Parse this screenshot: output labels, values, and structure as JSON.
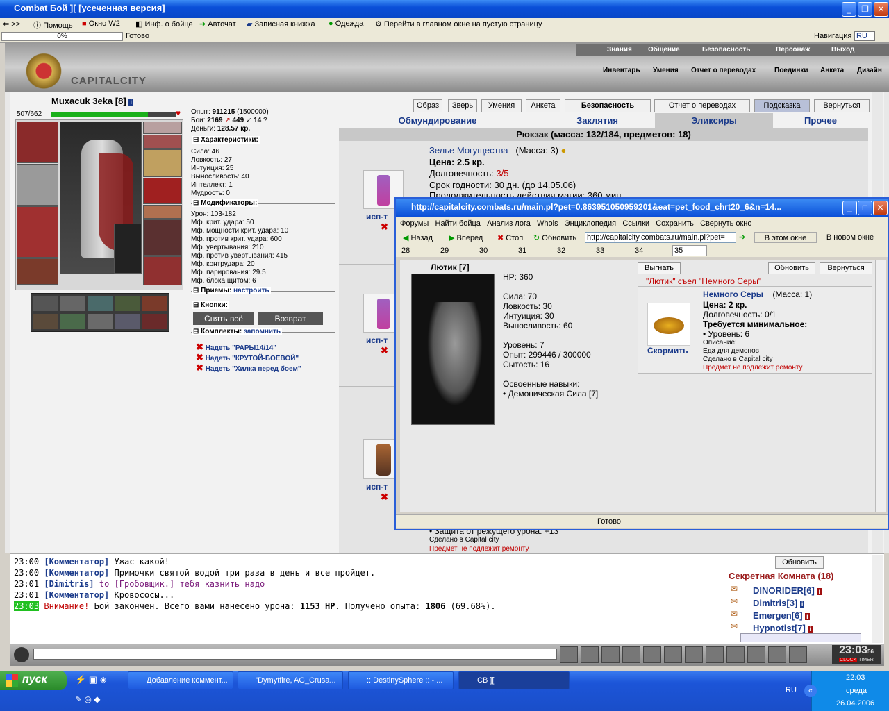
{
  "window": {
    "title": "Combat Бой ][ [усеченная версия]"
  },
  "toolbar": {
    "help": "Помощь",
    "window_w2": "Окно W2",
    "fighter_info": "Инф. о бойце",
    "autochat": "Авточат",
    "notebook": "Записная книжка",
    "clothing": "Одежда",
    "empty_page": "Перейти в главном окне на пустую страницу"
  },
  "status": {
    "progress": "0%",
    "ready": "Готово",
    "nav_label": "Навигация",
    "nav_value": "RU"
  },
  "header": {
    "logo_text": "CAPITALCITY",
    "top_nav": [
      "Знания",
      "Общение",
      "Безопасность",
      "Персонаж",
      "Выход"
    ],
    "sub_nav": [
      "Инвентарь",
      "Умения",
      "Отчет о переводах",
      "Поединки",
      "Анкета",
      "Дизайн"
    ]
  },
  "character": {
    "name": "Muxacuk 3eka",
    "level": "[8]",
    "hp": "507/662",
    "hp_fraction": 0.77,
    "exp_label": "Опыт:",
    "exp": "911215",
    "exp_next": "(1500000)",
    "fights_label": "Бои:",
    "fights": "2169",
    "wins": "449",
    "draws": "14",
    "money_label": "Деньги:",
    "money": "128.57 кр."
  },
  "stats": {
    "header": "Характеристики:",
    "items": [
      "Сила: 46",
      "Ловкость: 27",
      "Интуиция: 25",
      "Выносливость: 40",
      "Интеллект: 1",
      "Мудрость: 0"
    ]
  },
  "modifiers": {
    "header": "Модификаторы:",
    "items": [
      "Урон: 103-182",
      "Мф. крит. удара: 50",
      "Мф. мощности крит. удара: 10",
      "Мф. против крит. удара: 600",
      "Мф. увертывания: 210",
      "Мф. против увертывания: 415",
      "Мф. контрудара: 20",
      "Мф. парирования: 29.5",
      "Мф. блока щитом: 6"
    ]
  },
  "techniques": {
    "header": "Приемы:",
    "action": "настроить"
  },
  "buttons_sect": {
    "header": "Кнопки:",
    "remove_all": "Снять всё",
    "return": "Возврат"
  },
  "sets": {
    "header": "Комплекты:",
    "action": "запомнить",
    "items": [
      "Надеть \"РАРЫ14/14\"",
      "Надеть \"КРУТОЙ-БОЕВОЙ\"",
      "Надеть \"Хилка перед боем\""
    ]
  },
  "inv_buttons": [
    "Образ",
    "Зверь",
    "Умения",
    "Анкета",
    "Безопасность",
    "Отчет о переводах",
    "Подсказка",
    "Вернуться"
  ],
  "inv_tabs": [
    "Обмундирование",
    "Заклятия",
    "Эликсиры",
    "Прочее"
  ],
  "backpack": {
    "title": "Рюкзак (масса: 132/184, предметов: 18)",
    "use_label": "исп-т",
    "item": {
      "name": "Зелье Могущества",
      "mass": "(Масса: 3)",
      "price": "Цена: 2.5 кр.",
      "durability_label": "Долговечность:",
      "durability": "3/5",
      "shelf": "Срок годности: 30 дн. (до 14.05.06)",
      "duration": "Продолжительность действия магии: 360 мин."
    },
    "bottom_lines": [
      "• Защита от режущего урона: +13",
      "Сделано в Capital city"
    ],
    "no_repair": "Предмет не подлежит ремонту"
  },
  "popup": {
    "title": "http://capitalcity.combats.ru/main.pl?pet=0.863951050959201&eat=pet_food_chrt20_6&n=14...",
    "menu": [
      "Форумы",
      "Найти бойца",
      "Анализ лога",
      "Whois",
      "Энциклопедия",
      "Ссылки",
      "Сохранить",
      "Свернуть окно"
    ],
    "back": "Назад",
    "forward": "Вперед",
    "stop": "Стоп",
    "refresh": "Обновить",
    "url": "http://capitalcity.combats.ru/main.pl?pet=",
    "this_window": "В этом окне",
    "new_window": "В новом окне",
    "tabs": [
      "28",
      "29",
      "30",
      "31",
      "32",
      "33",
      "34",
      "35"
    ],
    "pet_name": "Лютик [7]",
    "pet_hp": "HP: 360",
    "pet_stats": [
      "Сила: 70",
      "Ловкость: 30",
      "Интуиция: 30",
      "Выносливость: 60"
    ],
    "pet_level": "Уровень: 7",
    "pet_exp": "Опыт: 299446 / 300000",
    "pet_fed": "Сытость: 16",
    "skills_label": "Освоенные навыки:",
    "skill": "• Демоническая Сила [7]",
    "btn_expel": "Выгнать",
    "btn_refresh": "Обновить",
    "btn_back": "Вернуться",
    "ate_msg": "\"Лютик\" съел \"Немного Серы\"",
    "food_name": "Немного Серы",
    "food_mass": "(Масса: 1)",
    "food_price": "Цена: 2 кр.",
    "food_durability": "Долговечность: 0/1",
    "food_req": "Требуется минимальное:",
    "food_level": "• Уровень: 6",
    "food_desc_label": "Описание:",
    "food_desc": "Еда для демонов",
    "food_made": "Сделано в Capital city",
    "food_norepair": "Предмет не подлежит ремонту",
    "feed": "Скормить",
    "status": "Готово"
  },
  "chat": [
    {
      "time": "23:00",
      "user": "[Комментатор]",
      "text": "Ужас какой!"
    },
    {
      "time": "23:00",
      "user": "[Комментатор]",
      "text": "Примочки святой водой три раза в день и все пройдет."
    },
    {
      "time": "23:01",
      "user": "[Dimitris]",
      "to": "to [Гробовщик.]",
      "text": "тебя казнить надо"
    },
    {
      "time": "23:01",
      "user": "[Комментатор]",
      "text": "Кровососы..."
    },
    {
      "time": "23:03",
      "warn": "Внимание!",
      "text": "Бой закончен. Всего вами нанесено урона: ",
      "dmg": "1153 HP",
      "text2": ". Получено опыта: ",
      "exp": "1806",
      "pct": "(69.68%)."
    }
  ],
  "room": {
    "refresh": "Обновить",
    "name": "Секретная Комната (18)",
    "users": [
      "DINORIDER[6]",
      "Dimitris[3]",
      "Emergen[6]",
      "Hypnotist[7]"
    ]
  },
  "clock": {
    "time": "23:03",
    "sec": "56",
    "clock_label": "CLOCK",
    "timer_label": "TIMER"
  },
  "taskbar": {
    "start": "пуск",
    "tasks": [
      "Добавление коммент...",
      "'Dymytfire, AG_Crusa...",
      ":: DestinySphere :: - ...",
      "CB ]["
    ],
    "lang": "RU",
    "time": "22:03",
    "day": "среда",
    "date": "26.04.2006"
  }
}
